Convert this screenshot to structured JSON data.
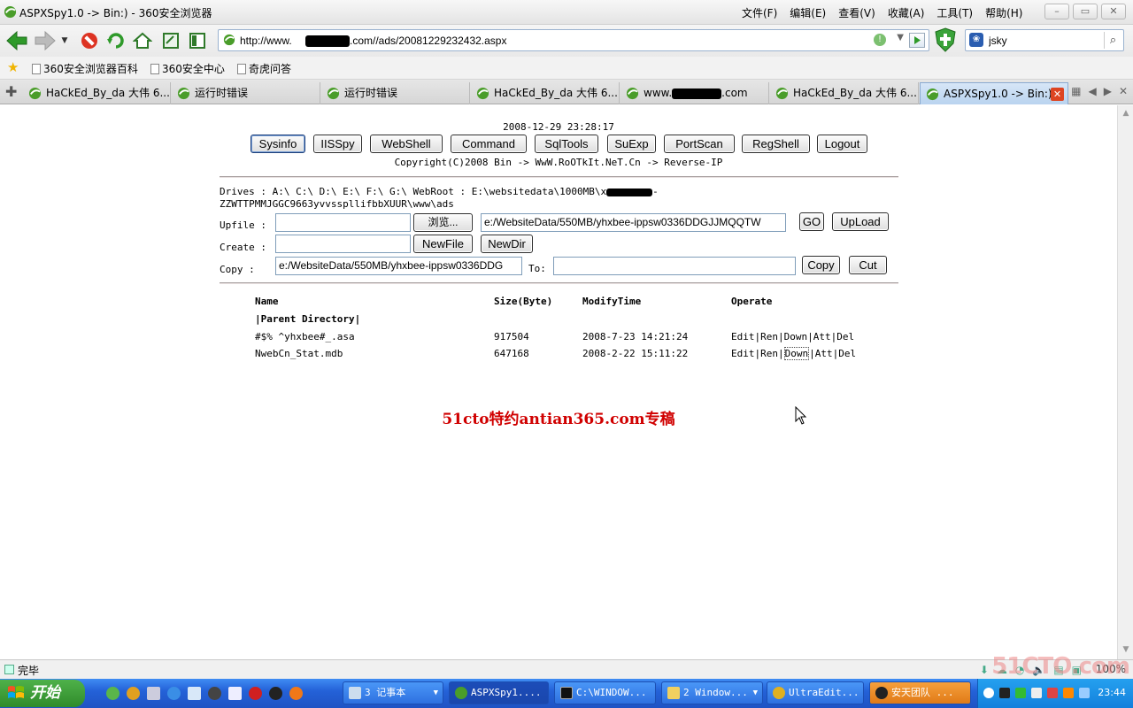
{
  "window": {
    "title": "ASPXSpy1.0 -> Bin:) - 360安全浏览器",
    "menu": [
      "文件(F)",
      "编辑(E)",
      "查看(V)",
      "收藏(A)",
      "工具(T)",
      "帮助(H)"
    ]
  },
  "address": {
    "url_prefix": "http://www.",
    "url_suffix": ".com//ads/20081229232432.aspx"
  },
  "search": {
    "value": "jsky"
  },
  "bookmarks": [
    "360安全浏览器百科",
    "360安全中心",
    "奇虎问答"
  ],
  "tabs": [
    {
      "label": "HaCkEd_By_da 大伟 6..."
    },
    {
      "label": "运行时错误"
    },
    {
      "label": "运行时错误"
    },
    {
      "label": "HaCkEd_By_da 大伟 6..."
    },
    {
      "label_prefix": "www.",
      "label_suffix": ".com"
    },
    {
      "label": "HaCkEd_By_da 大伟 6..."
    },
    {
      "label": "ASPXSpy1.0 -> Bin:)"
    }
  ],
  "page": {
    "datetime": "2008-12-29 23:28:17",
    "nav_buttons": [
      "Sysinfo",
      "IISSpy",
      "WebShell",
      "Command",
      "SqlTools",
      "SuExp",
      "PortScan",
      "RegShell",
      "Logout"
    ],
    "copyright": "Copyright(C)2008 Bin -> WwW.RoOTkIt.NeT.Cn -> Reverse-IP",
    "drives_line": "Drives : A:\\ C:\\ D:\\ E:\\ F:\\ G:\\  WebRoot : E:\\websitedata\\1000MB\\x",
    "drives_suffix": "-",
    "webroot_line2": "ZZWTTPMMJGGC9663yvvsspllifbbXUUR\\www\\ads",
    "upfile_label": "Upfile :",
    "browse_label": "浏览...",
    "upload_path": "e:/WebsiteData/550MB/yhxbee-ippsw0336DDGJJMQQTW",
    "go_label": "GO",
    "upload_label": "UpLoad",
    "create_label": "Create :",
    "newfile_label": "NewFile",
    "newdir_label": "NewDir",
    "copy_label": "Copy :",
    "copy_from": "e:/WebsiteData/550MB/yhxbee-ippsw0336DDG",
    "to_label": "To:",
    "copy_btn": "Copy",
    "cut_btn": "Cut",
    "table_headers": [
      "Name",
      "Size(Byte)",
      "ModifyTime",
      "Operate"
    ],
    "parent_dir": "|Parent Directory|",
    "files": [
      {
        "name": "#$% ^yhxbee#_.asa",
        "size": "917504",
        "time": "2008-7-23 14:21:24"
      },
      {
        "name": "NwebCn_Stat.mdb",
        "size": "647168",
        "time": "2008-2-22 15:11:22"
      }
    ],
    "ops": [
      "Edit",
      "Ren",
      "Down",
      "Att",
      "Del"
    ],
    "watermark": "51cto特约antian365.com专稿"
  },
  "status": {
    "text": "完毕",
    "zoom": "100%"
  },
  "taskbar": {
    "start": "开始",
    "tasks": [
      "3 记事本",
      "ASPXSpy1....",
      "C:\\WINDOW...",
      "2 Window...",
      "UltraEdit...",
      "安天团队 ..."
    ],
    "clock": "23:44"
  },
  "site_watermark": "51CTO.com",
  "colors": {
    "watermark_red": "#d00000",
    "taskbar_blue": "#2462d8",
    "start_green": "#3a9b35"
  }
}
